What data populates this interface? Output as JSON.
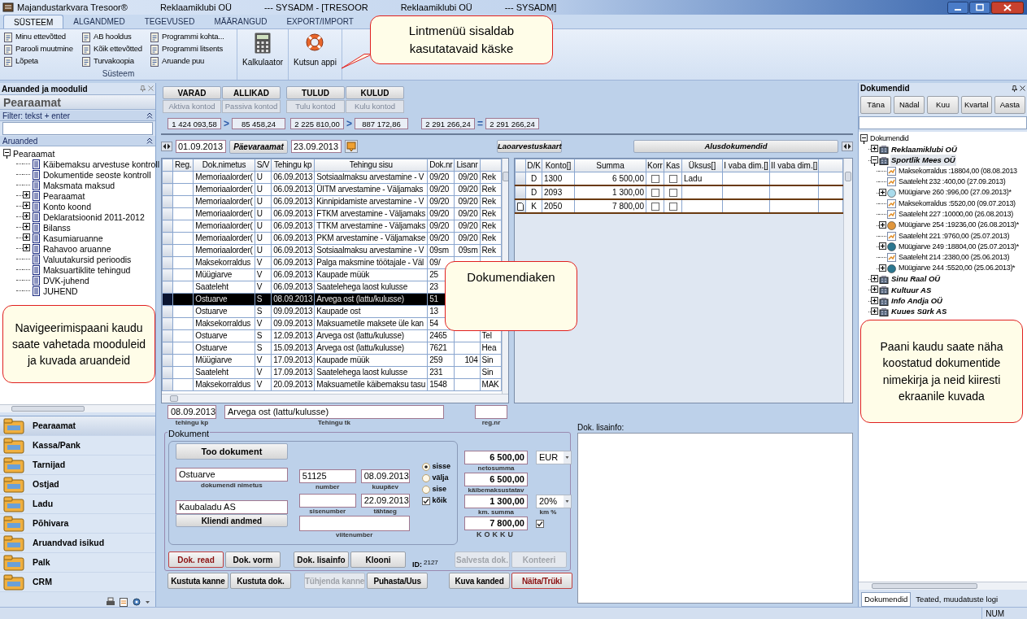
{
  "window": {
    "title_parts": [
      "Majandustarkvara Tresoor®",
      "Reklaamiklubi OÜ",
      "--- SYSADM - [TRESOOR",
      "Reklaamiklubi OÜ",
      "--- SYSADM]"
    ]
  },
  "ribbon": {
    "tabs": [
      {
        "label": "SÜSTEEM",
        "selected": true
      },
      {
        "label": "ALGANDMED",
        "selected": false
      },
      {
        "label": "TEGEVUSED",
        "selected": false
      },
      {
        "label": "MÄÄRANGUD",
        "selected": false
      },
      {
        "label": "EXPORT/IMPORT",
        "selected": false
      }
    ],
    "group": {
      "label": "Süsteem",
      "items": [
        "Minu ettevõtted",
        "Parooli muutmine",
        "Lõpeta",
        "AB hooldus",
        "Kõik ettevõtted",
        "Turvakoopia",
        "Programmi kohta...",
        "Programmi litsents",
        "Aruande puu"
      ]
    },
    "large_buttons": [
      {
        "kind": "calculator",
        "label": "Kalkulaator"
      },
      {
        "kind": "lifebuoy",
        "label": "Kutsun appi"
      }
    ]
  },
  "left_panel": {
    "title": "Aruanded ja moodulid",
    "header": "Pearaamat",
    "filter_label": "Filter: tekst + enter",
    "reports_label": "Aruanded",
    "tree": [
      {
        "label": "Pearaamat",
        "expanded": true,
        "children": [
          {
            "label": "Käibemaksu arvestuse kontroll"
          },
          {
            "label": "Dokumentide seoste kontroll"
          },
          {
            "label": "Maksmata maksud"
          },
          {
            "label": "Pearaamat",
            "expanded": false
          },
          {
            "label": "Konto koond",
            "expanded": false
          },
          {
            "label": "Deklaratsioonid 2011-2012",
            "expanded": false
          },
          {
            "label": "Bilanss",
            "expanded": false
          },
          {
            "label": "Kasumiaruanne",
            "expanded": false
          },
          {
            "label": "Rahavoo aruanne",
            "expanded": false
          },
          {
            "label": "Valuutakursid perioodis"
          },
          {
            "label": "Maksuartiklite tehingud"
          },
          {
            "label": "DVK-juhend"
          },
          {
            "label": "JUHEND"
          }
        ]
      }
    ],
    "modules": [
      {
        "label": "Pearaamat",
        "selected": true
      },
      {
        "label": "Kassa/Pank",
        "selected": false
      },
      {
        "label": "Tarnijad",
        "selected": false
      },
      {
        "label": "Ostjad",
        "selected": false
      },
      {
        "label": "Ladu",
        "selected": false
      },
      {
        "label": "Põhivara",
        "selected": false
      },
      {
        "label": "Aruandvad isikud",
        "selected": false
      },
      {
        "label": "Palk",
        "selected": false
      },
      {
        "label": "CRM",
        "selected": false
      }
    ]
  },
  "totals": {
    "buttons": [
      {
        "label": "VARAD",
        "sublabel": "Aktiva kontod"
      },
      {
        "label": "ALLIKAD",
        "sublabel": "Passiva kontod"
      },
      {
        "label": "TULUD",
        "sublabel": "Tulu kontod"
      },
      {
        "label": "KULUD",
        "sublabel": "Kulu kontod"
      }
    ],
    "summaries": [
      {
        "left": "1 424 093,58",
        "op": ">",
        "right": "85 458,24"
      },
      {
        "left": "2 225 810,00",
        "op": ">",
        "right": "887 172,86"
      },
      {
        "left": "2 291 266,24",
        "op": "=",
        "right": "2 291 266,24"
      }
    ]
  },
  "toolbar": {
    "date_from": "01.09.2013",
    "journal_button": "Päevaraamat",
    "date_to": "23.09.2013",
    "stock_button": "Laoarvestuskaart",
    "source_button": "Alusdokumendid"
  },
  "transactions": {
    "columns": [
      "Reg.",
      "Dok.nimetus",
      "S/V",
      "Tehingu kp",
      "Tehingu sisu",
      "Dok.nr",
      "Lisanr"
    ],
    "rows": [
      {
        "selected": false,
        "cells": [
          "",
          "Memoriaalorder(",
          "U",
          "06.09.2013",
          "Sotsiaalmaksu arvestamine - V",
          "09/20",
          "09/20",
          "Rek"
        ]
      },
      {
        "selected": false,
        "cells": [
          "",
          "Memoriaalorder(",
          "U",
          "06.09.2013",
          "ÜITM arvestamine - Väljamaks",
          "09/20",
          "09/20",
          "Rek"
        ]
      },
      {
        "selected": false,
        "cells": [
          "",
          "Memoriaalorder(",
          "U",
          "06.09.2013",
          "Kinnipidamiste arvestamine - V",
          "09/20",
          "09/20",
          "Rek"
        ]
      },
      {
        "selected": false,
        "cells": [
          "",
          "Memoriaalorder(",
          "U",
          "06.09.2013",
          "FTKM arvestamine - Väljamaks",
          "09/20",
          "09/20",
          "Rek"
        ]
      },
      {
        "selected": false,
        "cells": [
          "",
          "Memoriaalorder(",
          "U",
          "06.09.2013",
          "TTKM arvestamine - Väljamaks",
          "09/20",
          "09/20",
          "Rek"
        ]
      },
      {
        "selected": false,
        "cells": [
          "",
          "Memoriaalorder(",
          "U",
          "06.09.2013",
          "PKM arvestamine - Väljamakse",
          "09/20",
          "09/20",
          "Rek"
        ]
      },
      {
        "selected": false,
        "cells": [
          "",
          "Memoriaalorder(",
          "U",
          "06.09.2013",
          "Sotsiaalmaksu arvestamine - V",
          "09sm",
          "09sm",
          "Rek"
        ]
      },
      {
        "selected": false,
        "cells": [
          "",
          "Maksekorraldus",
          "V",
          "06.09.2013",
          "Palga maksmine töötajale - Väl",
          "09/",
          "",
          ""
        ]
      },
      {
        "selected": false,
        "cells": [
          "",
          "Müügiarve",
          "V",
          "06.09.2013",
          "Kaupade müük",
          "25",
          "",
          ""
        ]
      },
      {
        "selected": false,
        "cells": [
          "",
          "Saateleht",
          "V",
          "06.09.2013",
          "Saatelehega laost kulusse",
          "23",
          "",
          ""
        ]
      },
      {
        "selected": true,
        "cells": [
          "",
          "Ostuarve",
          "S",
          "08.09.2013",
          "Arvega ost (lattu/kulusse)",
          "51",
          "",
          ""
        ]
      },
      {
        "selected": false,
        "cells": [
          "",
          "Ostuarve",
          "S",
          "09.09.2013",
          "Kaupade ost",
          "13",
          "",
          ""
        ]
      },
      {
        "selected": false,
        "cells": [
          "",
          "Maksekorraldus",
          "V",
          "09.09.2013",
          "Maksuametile maksete üle kan",
          "54",
          "",
          ""
        ]
      },
      {
        "selected": false,
        "cells": [
          "",
          "Ostuarve",
          "S",
          "12.09.2013",
          "Arvega ost (lattu/kulusse)",
          "2465",
          "",
          "Tel"
        ]
      },
      {
        "selected": false,
        "cells": [
          "",
          "Ostuarve",
          "S",
          "15.09.2013",
          "Arvega ost (lattu/kulusse)",
          "7621",
          "",
          "Hea"
        ]
      },
      {
        "selected": false,
        "cells": [
          "",
          "Müügiarve",
          "V",
          "17.09.2013",
          "Kaupade müük",
          "259",
          "104",
          "Sin"
        ]
      },
      {
        "selected": false,
        "cells": [
          "",
          "Saateleht",
          "V",
          "17.09.2013",
          "Saatelehega laost kulusse",
          "231",
          "",
          "Sin"
        ]
      },
      {
        "selected": false,
        "cells": [
          "",
          "Maksekorraldus",
          "V",
          "20.09.2013",
          "Maksuametile käibemaksu tasu",
          "1548",
          "",
          "MAK"
        ]
      }
    ]
  },
  "entries": {
    "columns": [
      "D/K",
      "Konto[]",
      "Summa",
      "Korr",
      "Kas",
      "Üksus[]",
      "I vaba dim.[]",
      "II vaba dim.[]"
    ],
    "rows": [
      {
        "has_document": false,
        "dk": "D",
        "konto": "1300",
        "summa": "6 500,00",
        "korr": false,
        "kass": false,
        "yksus": "Ladu"
      },
      {
        "has_document": false,
        "dk": "D",
        "konto": "2093",
        "summa": "1 300,00",
        "korr": false,
        "kass": false
      },
      {
        "has_document": true,
        "dk": "K",
        "konto": "2050",
        "summa": "7 800,00",
        "korr": false,
        "kass": false
      }
    ]
  },
  "form": {
    "transaction_date": {
      "value": "08.09.2013",
      "label": "tehingu kp"
    },
    "transaction_text": {
      "value": "Arvega ost (lattu/kulusse)",
      "label": "Tehingu tk"
    },
    "reg_nr": {
      "label": "reg.nr"
    },
    "legend": "Dokument",
    "fetch_button": "Too dokument",
    "client_button": "Kliendi andmed",
    "doc_name": {
      "value": "Ostuarve",
      "label": "dokumendi nimetus"
    },
    "number": {
      "value": "51125",
      "label": "number"
    },
    "date": {
      "value": "08.09.2013",
      "label": "kuupäev"
    },
    "client": {
      "value": "Kaubaladu AS"
    },
    "internal_number": {
      "label": "sisenumber"
    },
    "due_date": {
      "value": "22.09.2013",
      "label": "tähtaeg"
    },
    "reference_number": {
      "label": "viitenumber"
    },
    "directions": [
      {
        "label": "sisse",
        "selected": true
      },
      {
        "label": "välja",
        "selected": false
      },
      {
        "label": "sise",
        "selected": false
      }
    ],
    "all": {
      "label": "kõik",
      "checked": true
    },
    "net": {
      "value": "6 500,00",
      "label": "netosumma"
    },
    "currency": "EUR",
    "taxable": {
      "value": "6 500,00",
      "label": "käibemaksustatav"
    },
    "vat": {
      "value": "1 300,00",
      "label": "km. summa"
    },
    "vat_rate": {
      "value": "20%",
      "label": "km %"
    },
    "total": {
      "value": "7 800,00",
      "label": "KOKKU",
      "checked": true
    },
    "doc_buttons": [
      {
        "label": "Dok. read",
        "disabled": false,
        "accent": true
      },
      {
        "label": "Dok. vorm",
        "disabled": false,
        "accent": false
      },
      {
        "label": "Dok. lisainfo",
        "disabled": false,
        "accent": false
      },
      {
        "label": "Klooni",
        "disabled": false,
        "accent": false
      }
    ],
    "id_label": "ID:",
    "id": "2127",
    "save_buttons": [
      {
        "label": "Salvesta dok.",
        "disabled": true,
        "accent": false
      },
      {
        "label": "Konteeri",
        "disabled": true,
        "accent": false
      }
    ],
    "bottom_buttons": [
      {
        "label": "Kustuta kanne",
        "disabled": false,
        "accent": false
      },
      {
        "label": "Kustuta dok.",
        "disabled": false,
        "accent": false
      },
      {
        "label": "Tühjenda kanne",
        "disabled": true,
        "accent": false
      },
      {
        "label": "Puhasta/Uus",
        "disabled": false,
        "accent": false
      },
      {
        "label": "Kuva kanded",
        "disabled": false,
        "accent": false
      },
      {
        "label": "Näita/Trüki",
        "disabled": false,
        "accent": true
      }
    ],
    "notes_label": "Dok. lisainfo:"
  },
  "documents_panel": {
    "title": "Dokumendid",
    "periods": [
      "Täna",
      "Nädal",
      "Kuu",
      "Kvartal",
      "Aasta"
    ],
    "tree": [
      {
        "label": "Dokumendid",
        "expanded": true,
        "selected": false,
        "children": [
          {
            "label": "Reklaamiklubi OÜ",
            "kind": "company",
            "expanded": false,
            "selected": false
          },
          {
            "label": "Sportlik Mees OÜ",
            "kind": "company",
            "expanded": true,
            "selected": true,
            "children": [
              {
                "label": "Maksekorraldus :18804,00 (08.08.2013",
                "kind": "document",
                "selected": false
              },
              {
                "label": "Saateleht 232 :400,00 (27.09.2013)",
                "kind": "document",
                "selected": false
              },
              {
                "label": "Müügiarve 260 :996,00 (27.09.2013)*",
                "kind": "invoice",
                "color": "#a9dbec",
                "expanded": false,
                "selected": false
              },
              {
                "label": "Maksekorraldus :5520,00 (09.07.2013)",
                "kind": "document",
                "selected": false
              },
              {
                "label": "Saateleht 227 :10000,00 (26.08.2013)",
                "kind": "document",
                "selected": false
              },
              {
                "label": "Müügiarve 254 :19236,00 (26.08.2013)*",
                "kind": "invoice",
                "color": "#e0963c",
                "expanded": false,
                "selected": false
              },
              {
                "label": "Saateleht 221 :9760,00 (25.07.2013)",
                "kind": "document",
                "selected": false
              },
              {
                "label": "Müügiarve 249 :18804,00 (25.07.2013)*",
                "kind": "invoice",
                "color": "#2c7790",
                "expanded": false,
                "selected": false
              },
              {
                "label": "Saateleht 214 :2380,00 (25.06.2013)",
                "kind": "document",
                "selected": false
              },
              {
                "label": "Müügiarve 244 :5520,00 (25.06.2013)*",
                "kind": "invoice",
                "color": "#2c7790",
                "expanded": false,
                "selected": false
              }
            ]
          },
          {
            "label": "Sinu Raal OÜ",
            "kind": "company",
            "expanded": false,
            "selected": false
          },
          {
            "label": "Kultuur AS",
            "kind": "company",
            "expanded": false,
            "selected": false
          },
          {
            "label": "Info Andja OÜ",
            "kind": "company",
            "expanded": false,
            "selected": false
          },
          {
            "label": "Kuues Sürk AS",
            "kind": "company",
            "expanded": false,
            "selected": false
          }
        ]
      }
    ],
    "tabs": [
      {
        "label": "Dokumendid",
        "selected": true
      },
      {
        "label": "Teated, muudatuste logi",
        "selected": false
      }
    ]
  },
  "callouts": [
    "Lintmenüü sisaldab kasutatavaid käske",
    "Navigeerimispaani kaudu saate vahetada mooduleid ja  kuvada aruandeid",
    "Dokumendiaken",
    "Paani kaudu saate näha koostatud dokumentide nimekirja ja neid kiiresti ekraanile kuvada"
  ],
  "status_bar": {
    "indicator": "NUM"
  }
}
